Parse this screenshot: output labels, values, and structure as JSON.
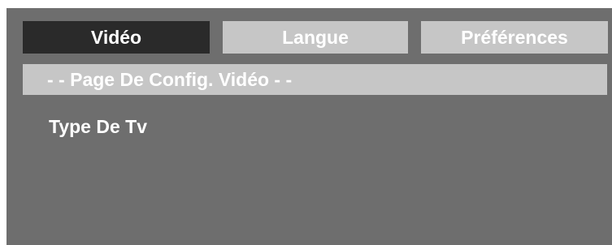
{
  "tabs": [
    {
      "label": "Vidéo",
      "active": true
    },
    {
      "label": "Langue",
      "active": false
    },
    {
      "label": "Préférences",
      "active": false
    }
  ],
  "page_header": "- - Page De Config. Vidéo - -",
  "menu_items": [
    {
      "label": "Type De Tv"
    }
  ],
  "colors": {
    "screen_background": "#6e6e6e",
    "active_tab": "#2a2a2a",
    "inactive_tab": "#c6c6c6",
    "text": "#ffffff"
  }
}
